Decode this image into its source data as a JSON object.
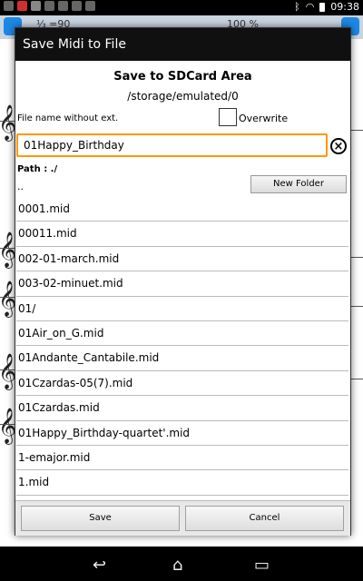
{
  "status_bar": {
    "battery_percent": "100 %",
    "time": "09:38"
  },
  "background_app": {
    "toolbar_text_left": "⅓ =90",
    "toolbar_text_right": "100 %"
  },
  "dialog": {
    "title": "Save Midi to File",
    "heading": "Save to SDCard Area",
    "storage_path": "/storage/emulated/0",
    "filename_label": "File name without ext.",
    "overwrite_label": "Overwrite",
    "overwrite_checked": false,
    "filename_value": "01Happy_Birthday",
    "path_label": "Path : ./",
    "parent_dir": "..",
    "new_folder_label": "New Folder",
    "files": [
      "0001.mid",
      "00011.mid",
      "002-01-march.mid",
      "003-02-minuet.mid",
      "01/",
      "01Air_on_G.mid",
      "01Andante_Cantabile.mid",
      "01Czardas-05(7).mid",
      "01Czardas.mid",
      "01Happy_Birthday-quartet'.mid",
      "1-emajor.mid",
      "1.mid"
    ],
    "save_label": "Save",
    "cancel_label": "Cancel"
  },
  "icons": {
    "clear": "close-circle-icon",
    "nav_back": "back-icon",
    "nav_home": "home-icon",
    "nav_recent": "recent-apps-icon",
    "wifi": "wifi-icon",
    "battery": "battery-icon"
  },
  "colors": {
    "input_focus_border": "#ff9800",
    "title_bar": "#101010"
  }
}
